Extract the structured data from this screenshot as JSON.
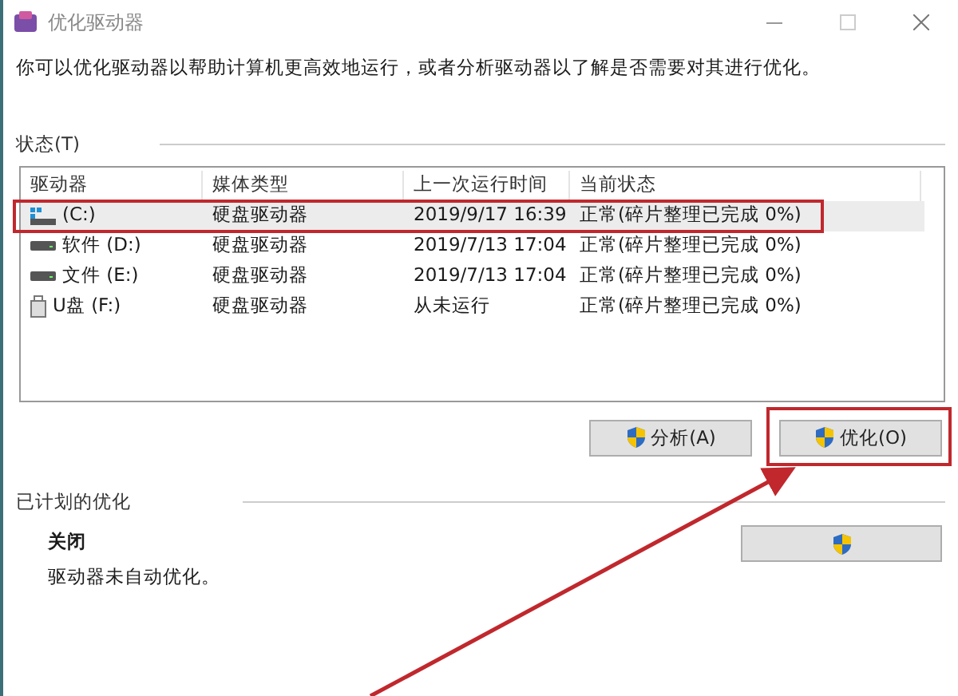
{
  "window": {
    "title": "优化驱动器"
  },
  "description": "你可以优化驱动器以帮助计算机更高效地运行，或者分析驱动器以了解是否需要对其进行优化。",
  "status_section": {
    "title": "状态(T)"
  },
  "table": {
    "columns": [
      "驱动器",
      "媒体类型",
      "上一次运行时间",
      "当前状态"
    ],
    "rows": [
      {
        "kind": "system",
        "drive": "(C:)",
        "media": "硬盘驱动器",
        "last_run": "2019/9/17 16:39",
        "status": "正常(碎片整理已完成 0%)",
        "selected": true,
        "highlighted": true
      },
      {
        "kind": "disk",
        "drive": "软件 (D:)",
        "media": "硬盘驱动器",
        "last_run": "2019/7/13 17:04",
        "status": "正常(碎片整理已完成 0%)",
        "selected": false,
        "highlighted": false
      },
      {
        "kind": "disk",
        "drive": "文件 (E:)",
        "media": "硬盘驱动器",
        "last_run": "2019/7/13 17:04",
        "status": "正常(碎片整理已完成 0%)",
        "selected": false,
        "highlighted": false
      },
      {
        "kind": "usb",
        "drive": "U盘 (F:)",
        "media": "硬盘驱动器",
        "last_run": "从未运行",
        "status": "正常(碎片整理已完成 0%)",
        "selected": false,
        "highlighted": false
      }
    ]
  },
  "buttons": [
    {
      "label": "分析(A)",
      "highlighted": false
    },
    {
      "label": "优化(O)",
      "highlighted": true
    }
  ],
  "scheduled_section": {
    "title": "已计划的优化",
    "state": "关闭",
    "note": "驱动器未自动优化。"
  }
}
